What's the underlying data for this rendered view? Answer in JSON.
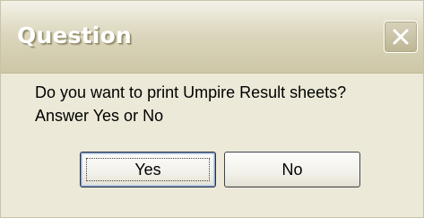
{
  "window": {
    "title": "Question",
    "close_icon": "close-icon"
  },
  "message": {
    "line1": "Do you want to print Umpire Result sheets?",
    "line2": "Answer Yes or No"
  },
  "buttons": {
    "yes_label": "Yes",
    "no_label": "No"
  }
}
